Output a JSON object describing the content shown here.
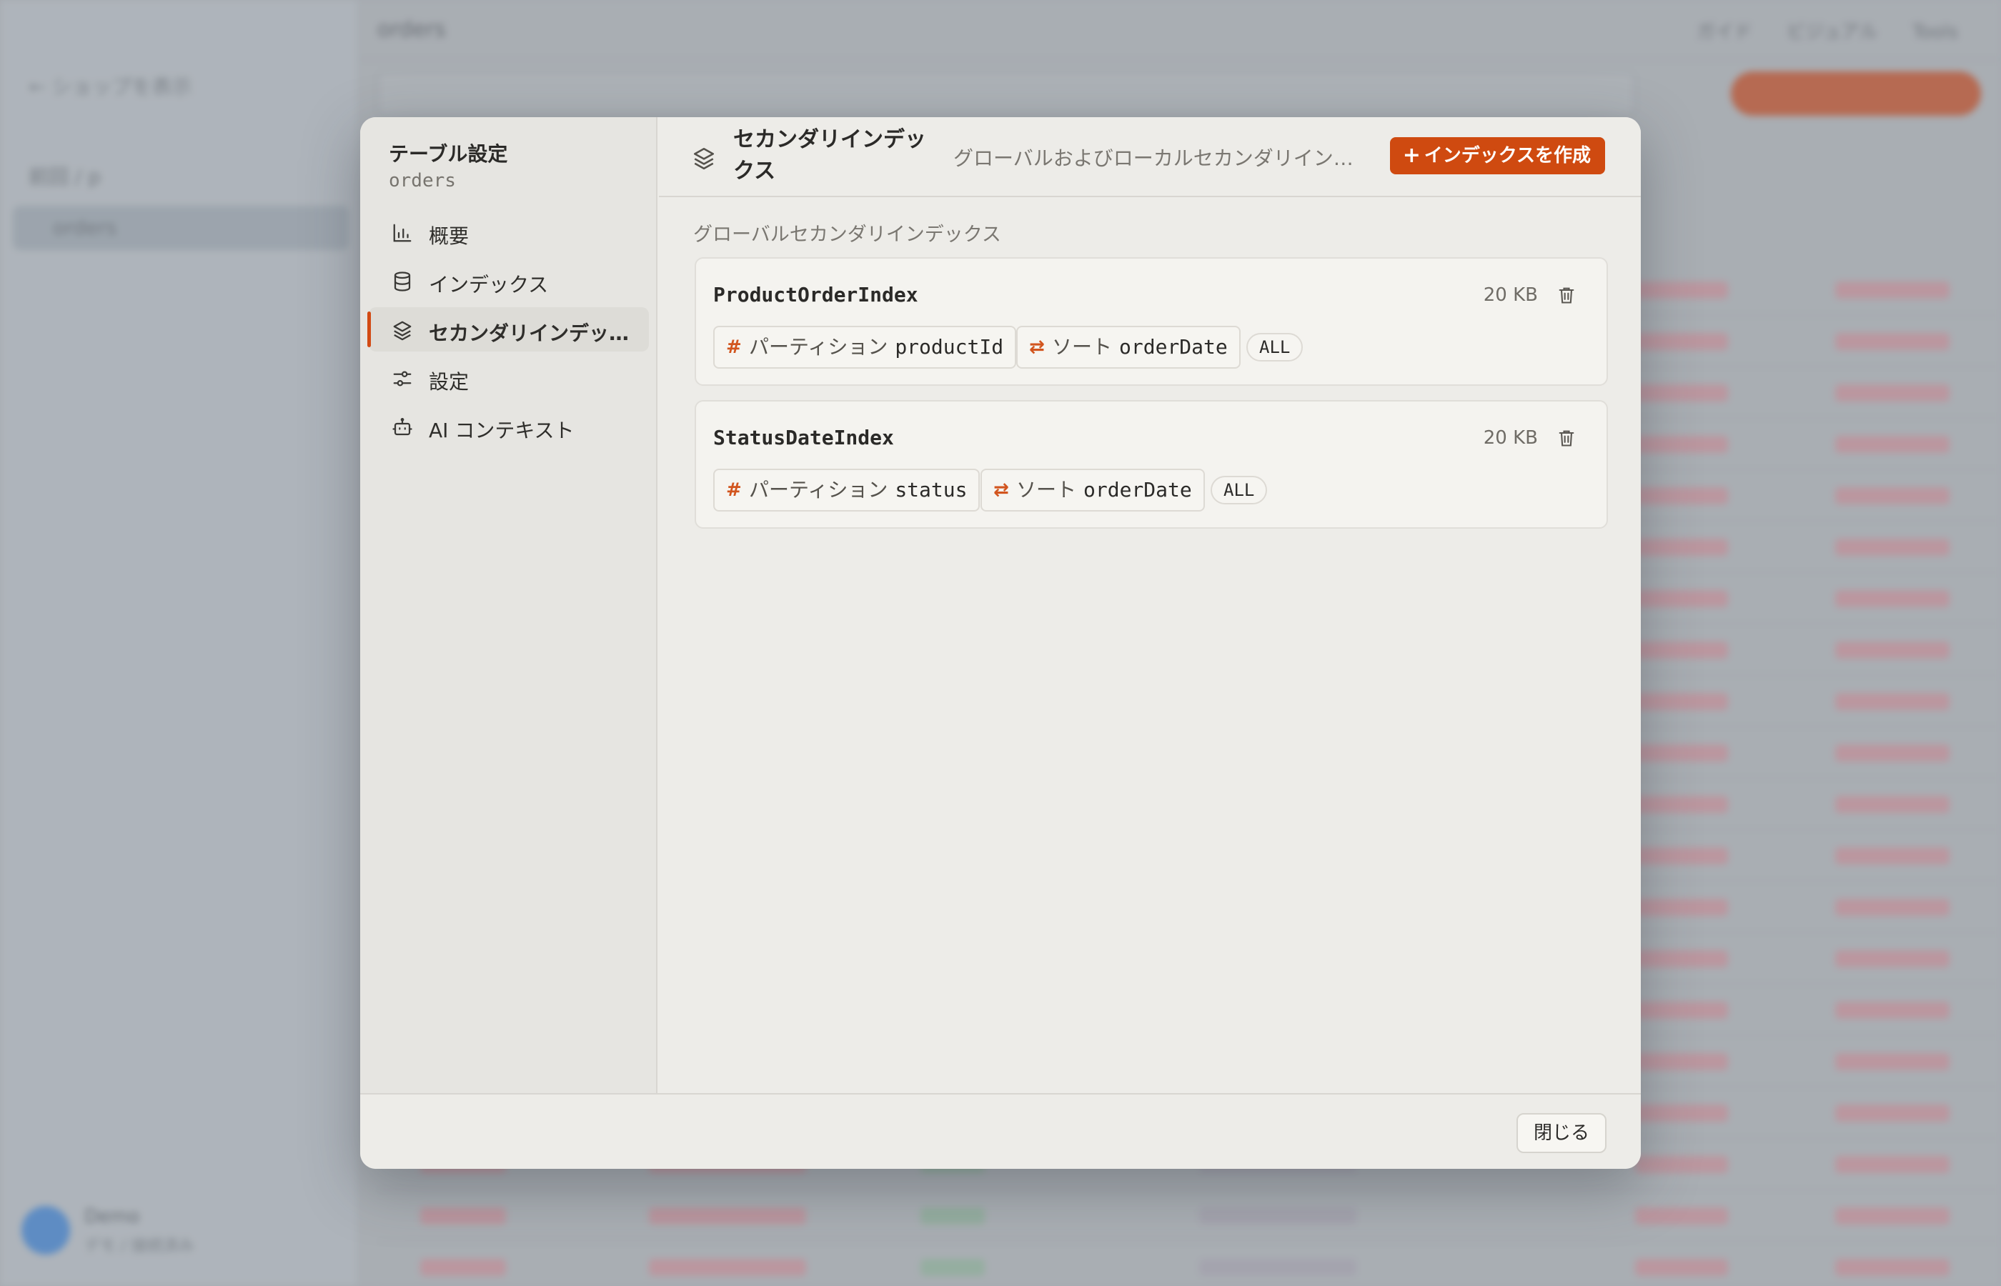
{
  "background": {
    "sidebar_back": "← ショップを表示",
    "sidebar_items": [
      "前回 / p",
      "orders"
    ],
    "user_name": "Demo",
    "user_sub": "デモ / 接続済み",
    "table_name": "orders",
    "top_links": [
      "ガイド",
      "ビジュアル",
      "Tools"
    ]
  },
  "modal": {
    "sidebar": {
      "title": "テーブル設定",
      "subtitle": "orders",
      "nav": [
        {
          "label": "概要",
          "icon": "bar-chart-icon",
          "active": false
        },
        {
          "label": "インデックス",
          "icon": "database-icon",
          "active": false
        },
        {
          "label": "セカンダリインデックス",
          "icon": "layers-icon",
          "active": true
        },
        {
          "label": "設定",
          "icon": "sliders-icon",
          "active": false
        },
        {
          "label": "AI コンテキスト",
          "icon": "robot-icon",
          "active": false
        }
      ]
    },
    "header": {
      "title": "セカンダリインデックス",
      "description": "グローバルおよびローカルセカンダリインデックス",
      "create_button": "インデックスを作成"
    },
    "section_title": "グローバルセカンダリインデックス",
    "indexes": [
      {
        "name": "ProductOrderIndex",
        "size": "20 KB",
        "partition_label": "パーティション",
        "partition_key": "productId",
        "sort_label": "ソート",
        "sort_key": "orderDate",
        "projection": "ALL"
      },
      {
        "name": "StatusDateIndex",
        "size": "20 KB",
        "partition_label": "パーティション",
        "partition_key": "status",
        "sort_label": "ソート",
        "sort_key": "orderDate",
        "projection": "ALL"
      }
    ],
    "footer": {
      "close_button": "閉じる"
    }
  },
  "colors": {
    "accent": "#cf4a10",
    "modal_bg": "#edece8",
    "sidebar_bg": "#e6e5e1"
  }
}
